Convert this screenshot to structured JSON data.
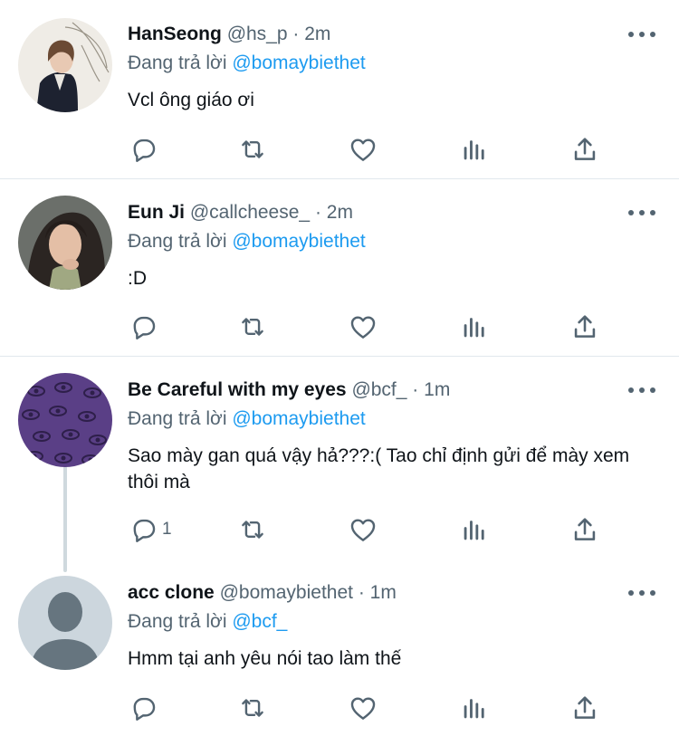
{
  "tweets": [
    {
      "name": "HanSeong",
      "handle": "@hs_p",
      "separator": "·",
      "time": "2m",
      "reply_prefix": "Đang trả lời",
      "reply_to": "@bomaybiethet",
      "text": "Vcl ông giáo ơi",
      "reply_count": ""
    },
    {
      "name": "Eun Ji",
      "handle": "@callcheese_",
      "separator": "·",
      "time": "2m",
      "reply_prefix": "Đang trả lời",
      "reply_to": "@bomaybiethet",
      "text": ":D",
      "reply_count": ""
    },
    {
      "name": "Be Careful with my eyes",
      "handle": "@bcf_",
      "separator": "·",
      "time": "1m",
      "reply_prefix": "Đang trả lời",
      "reply_to": "@bomaybiethet",
      "text": "Sao mày gan quá vậy hả???:( Tao chỉ định gửi để mày xem thôi mà",
      "reply_count": "1"
    },
    {
      "name": "acc clone",
      "handle": "@bomaybiethet",
      "separator": "·",
      "time": "1m",
      "reply_prefix": "Đang trả lời",
      "reply_to": "@bcf_",
      "text": "Hmm tại anh yêu nói tao làm thế",
      "reply_count": ""
    }
  ],
  "icons": {
    "reply": "reply-icon",
    "retweet": "retweet-icon",
    "like": "heart-icon",
    "stats": "stats-icon",
    "share": "share-icon",
    "more": "more-icon"
  },
  "colors": {
    "text": "#0f1419",
    "secondary": "#536471",
    "mention": "#1d9bf0",
    "divider": "#e1e8ed",
    "thread_line": "#cfd9de"
  }
}
